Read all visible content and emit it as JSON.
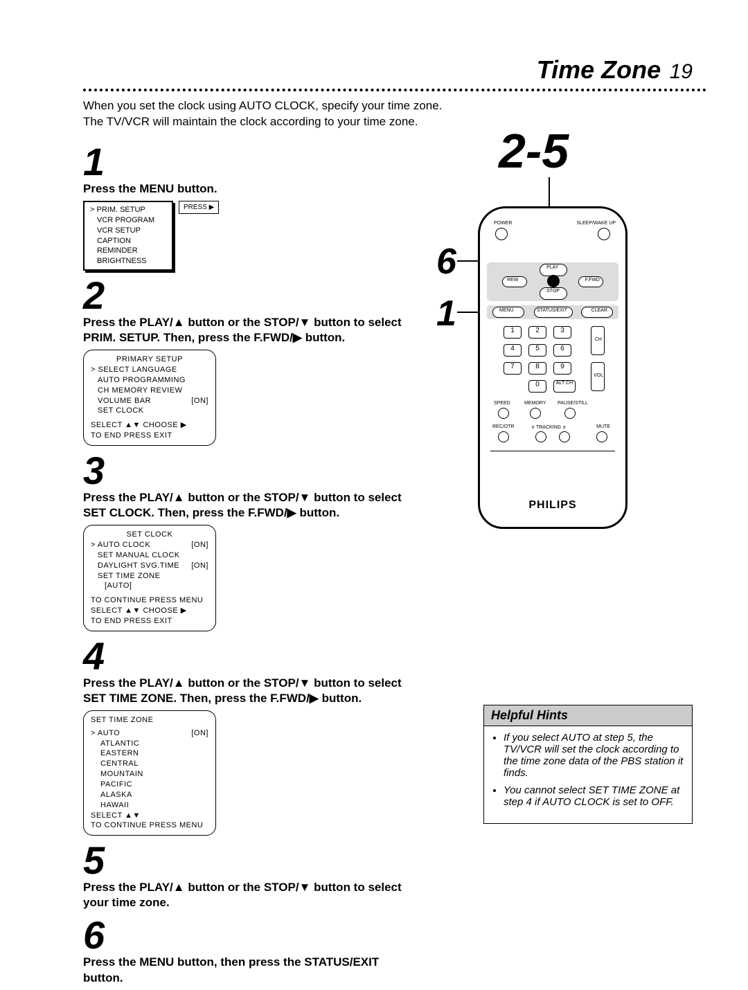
{
  "header": {
    "title": "Time Zone",
    "page_number": "19"
  },
  "intro": "When you set the clock using AUTO CLOCK, specify your time zone.\nThe TV/VCR will maintain the clock according to your time zone.",
  "steps": {
    "s1": {
      "num": "1",
      "text": "Press the MENU button."
    },
    "s2": {
      "num": "2",
      "text_a": "Press the PLAY/▲ button or the STOP/▼ button to select",
      "text_b": "PRIM. SETUP.  Then, press the F.FWD/▶ button."
    },
    "s3": {
      "num": "3",
      "text_a": "Press the PLAY/▲ button or the STOP/▼ button to select",
      "text_b": "SET CLOCK. Then, press the F.FWD/▶ button."
    },
    "s4": {
      "num": "4",
      "text_a": "Press the PLAY/▲ button or the STOP/▼ button to select",
      "text_b": "SET TIME ZONE. Then, press the F.FWD/▶ button."
    },
    "s5": {
      "num": "5",
      "text_a": "Press the PLAY/▲ button or the STOP/▼ button to select",
      "text_b": "your time zone."
    },
    "s6": {
      "num": "6",
      "text_a": "Press the MENU button, then press the STATUS/EXIT",
      "text_b": "button."
    }
  },
  "osd1": {
    "items": [
      "PRIM. SETUP",
      "VCR PROGRAM",
      "VCR SETUP",
      "CAPTION",
      "REMINDER",
      "BRIGHTNESS"
    ],
    "press_label": "PRESS ▶"
  },
  "osd2": {
    "title": "PRIMARY SETUP",
    "items": [
      "SELECT LANGUAGE",
      "AUTO PROGRAMMING",
      "CH MEMORY REVIEW"
    ],
    "volbar_label": "VOLUME BAR",
    "volbar_val": "[ON]",
    "last": "SET CLOCK",
    "footer1": "SELECT ▲▼ CHOOSE ▶",
    "footer2": "TO  END  PRESS  EXIT"
  },
  "osd3": {
    "title": "SET CLOCK",
    "auto_label": "AUTO CLOCK",
    "auto_val": "[ON]",
    "man": "SET MANUAL CLOCK",
    "dst_label": "DAYLIGHT SVG.TIME",
    "dst_val": "[ON]",
    "stz": "SET TIME ZONE",
    "stz_val": "[AUTO]",
    "cont": "TO CONTINUE PRESS MENU",
    "footer1": "SELECT ▲▼ CHOOSE ▶",
    "footer2": "TO  END  PRESS  EXIT"
  },
  "osd4": {
    "title": "SET TIME ZONE",
    "auto_label": "AUTO",
    "auto_val": "[ON]",
    "zones": [
      "ATLANTIC",
      "EASTERN",
      "CENTRAL",
      "MOUNTAIN",
      "PACIFIC",
      "ALASKA",
      "HAWAII"
    ],
    "footer1": "SELECT ▲▼",
    "footer2": "TO CONTINUE PRESS MENU"
  },
  "callouts": {
    "top": "2-5",
    "mid": "6",
    "bot": "1"
  },
  "remote": {
    "brand": "PHILIPS",
    "power": "POWER",
    "sleep": "SLEEP/WAKE UP",
    "play": "PLAY",
    "rew": "REW",
    "ffwd": "F.FWD",
    "stop": "STOP",
    "menu": "MENU",
    "status": "STATUS/EXIT",
    "clear": "CLEAR",
    "ch": "CH",
    "vol": "VOL",
    "altch": "ALT CH",
    "speed": "SPEED",
    "memory": "MEMORY",
    "pause": "PAUSE/STILL",
    "rec": "REC/OTR",
    "tracking": "TRACKING",
    "mute": "MUTE",
    "digits": [
      "1",
      "2",
      "3",
      "4",
      "5",
      "6",
      "7",
      "8",
      "9",
      "0"
    ]
  },
  "hints": {
    "title": "Helpful Hints",
    "h1": "If you select AUTO at step 5, the TV/VCR will set the clock according to the time zone data of the PBS station it finds.",
    "h2": "You cannot select SET TIME ZONE at step 4 if AUTO CLOCK is set to OFF."
  }
}
